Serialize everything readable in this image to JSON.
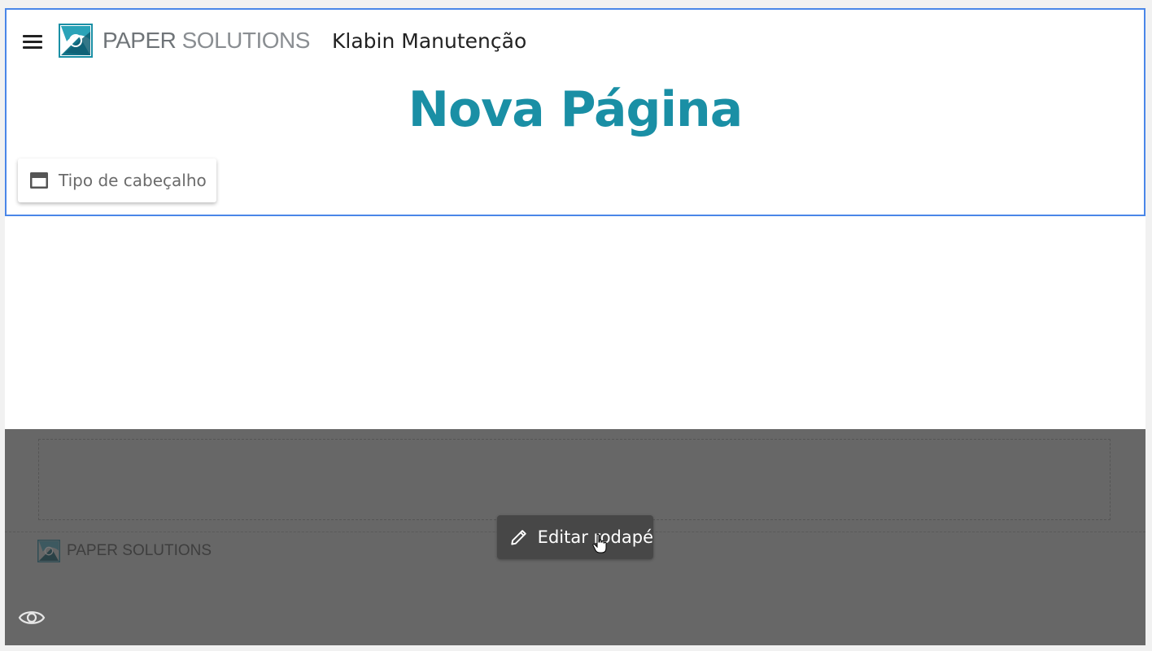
{
  "header": {
    "menu_icon": "menu-icon",
    "logo_text_dark": "PAPER ",
    "logo_text_light": "SOLUTIONS",
    "app_title": "Klabin Manutenção",
    "page_title": "Nova Página",
    "header_type_button": {
      "icon": "header-layout-icon",
      "label": "Tipo de cabeçalho"
    }
  },
  "footer": {
    "logo_text": "PAPER SOLUTIONS",
    "edit_button": {
      "icon": "pencil-icon",
      "label": "Editar rodapé"
    },
    "preview_icon": "eye-icon"
  },
  "colors": {
    "accent": "#1a8fa5",
    "header_border": "#4a86e8",
    "footer_bg": "#676767",
    "edit_button_bg": "#474747"
  }
}
